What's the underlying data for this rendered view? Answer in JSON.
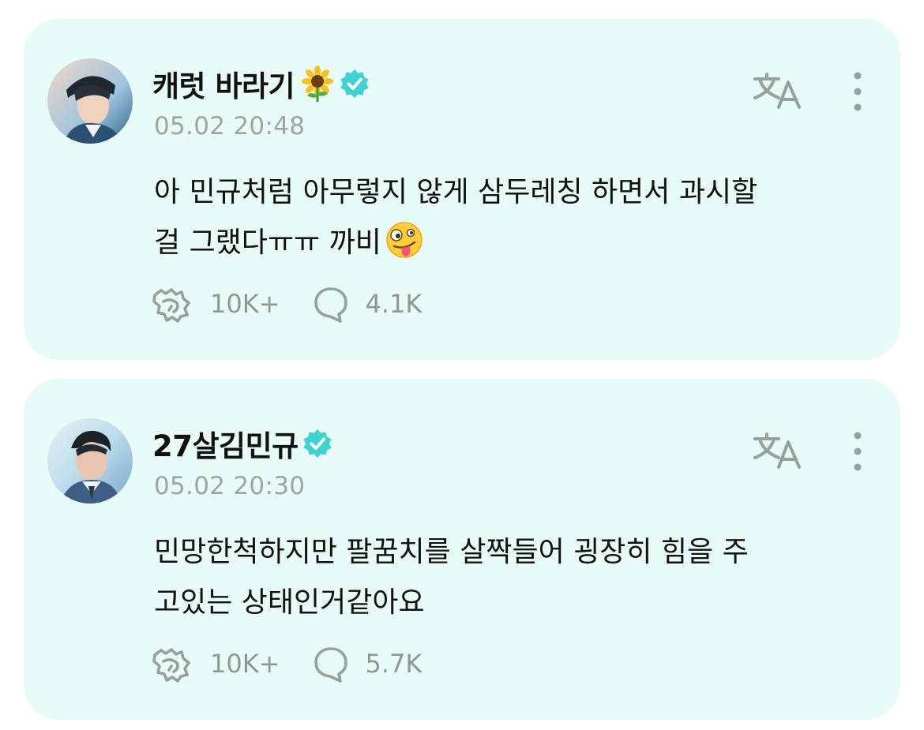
{
  "colors": {
    "card_background": "#e9fbf6",
    "verified_badge": "#3fd2d0",
    "icon_gray": "#94a29e",
    "timestamp_gray": "#9aa7a3"
  },
  "posts": [
    {
      "username": "캐럿 바라기",
      "username_emoji": "sunflower",
      "verified": true,
      "timestamp": "05.02 20:48",
      "text_lines": [
        "아 민규처럼 아무렇지 않게 삼두레칭 하면서 과시할",
        "걸 그랬다ㅠㅠ 까비"
      ],
      "text_emoji": "zany-face",
      "reactions": "10K+",
      "comments": "4.1K",
      "icons": [
        "translate-icon",
        "more-vertical-icon",
        "reaction-icon",
        "comment-icon"
      ]
    },
    {
      "username": "27살김민규",
      "verified": true,
      "timestamp": "05.02 20:30",
      "text_lines": [
        "민망한척하지만 팔꿈치를 살짝들어 굉장히 힘을 주",
        "고있는 상태인거같아요"
      ],
      "reactions": "10K+",
      "comments": "5.7K",
      "icons": [
        "translate-icon",
        "more-vertical-icon",
        "reaction-icon",
        "comment-icon"
      ]
    }
  ]
}
